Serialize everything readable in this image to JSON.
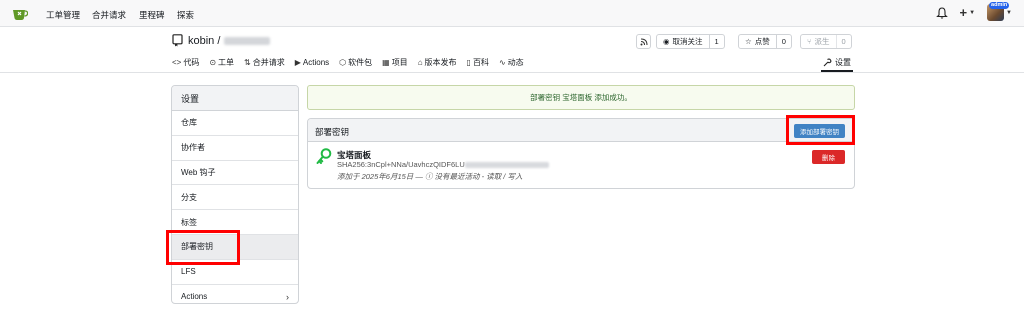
{
  "topnav": {
    "links": [
      "工单管理",
      "合并请求",
      "里程碑",
      "探索"
    ],
    "plus_label": "+",
    "avatar_badge": "admin"
  },
  "repo": {
    "owner": "kobin /",
    "watch_label": "取消关注",
    "watch_count": "1",
    "star_label": "点赞",
    "star_count": "0",
    "fork_label": "派生",
    "fork_count": "0",
    "tabs": [
      {
        "icon": "<>",
        "label": "代码"
      },
      {
        "icon": "⊙",
        "label": "工单"
      },
      {
        "icon": "⇅",
        "label": "合并请求"
      },
      {
        "icon": "▶",
        "label": "Actions"
      },
      {
        "icon": "⬡",
        "label": "软件包"
      },
      {
        "icon": "▦",
        "label": "项目"
      },
      {
        "icon": "⌂",
        "label": "版本发布"
      },
      {
        "icon": "▯",
        "label": "百科"
      },
      {
        "icon": "∿",
        "label": "动态"
      }
    ],
    "settings_tab": "设置"
  },
  "sidebar": {
    "header": "设置",
    "items": [
      "仓库",
      "协作者",
      "Web 钩子",
      "分支",
      "标签",
      "部署密钥",
      "LFS",
      "Actions"
    ],
    "active_index": 5
  },
  "flash": {
    "message": "部署密钥 宝塔面板 添加成功。"
  },
  "deploy_keys": {
    "title": "部署密钥",
    "add_button": "添加部署密钥",
    "keys": [
      {
        "name": "宝塔面板",
        "fingerprint": "SHA256:3nCpl+NNa/UavhczQIDF6LU",
        "meta": "添加于 2025年6月15日 — ⓘ 没有最近活动 - 读取 / 写入",
        "delete_button": "删除"
      }
    ]
  },
  "colors": {
    "primary_button": "#4183c4",
    "danger_button": "#db2828",
    "success_bg": "#f7fbef",
    "success_text": "#2c662d",
    "key_icon": "#21ba45",
    "highlight": "#ff0000"
  }
}
